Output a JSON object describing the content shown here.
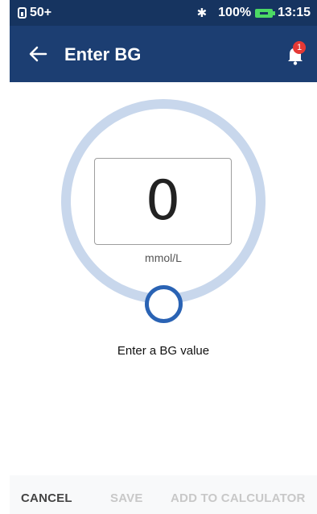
{
  "status_bar": {
    "signal_text": "50+",
    "battery_percent": "100%",
    "time": "13:15",
    "icons": [
      "sim-icon",
      "bluetooth-icon",
      "battery-charging-icon"
    ]
  },
  "app_bar": {
    "title": "Enter BG",
    "notification_count": "1",
    "icons": [
      "back-arrow-icon",
      "bell-icon"
    ]
  },
  "bg_entry": {
    "value": "0",
    "unit": "mmol/L",
    "prompt": "Enter a BG value"
  },
  "actions": {
    "cancel": "CANCEL",
    "save": "SAVE",
    "add_to_calculator": "ADD TO CALCULATOR"
  },
  "colors": {
    "status_bar": "#163460",
    "app_bar": "#1c3e72",
    "ring": "#c8d7ec",
    "handle": "#2a63b4",
    "badge": "#e53935",
    "battery": "#4cd964",
    "disabled_text": "#c8c8c8"
  }
}
